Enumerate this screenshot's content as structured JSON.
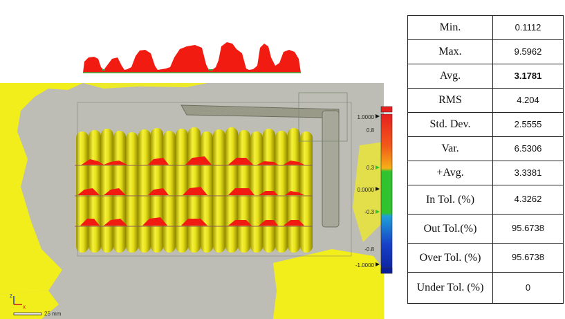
{
  "stats": [
    {
      "label": "Min.",
      "value": "0.1112"
    },
    {
      "label": "Max.",
      "value": "9.5962"
    },
    {
      "label": "Avg.",
      "value": "3.1781"
    },
    {
      "label": "RMS",
      "value": "4.204"
    },
    {
      "label": "Std. Dev.",
      "value": "2.5555"
    },
    {
      "label": "Var.",
      "value": "6.5306"
    },
    {
      "label": "+Avg.",
      "value": "3.3381"
    },
    {
      "label": "In Tol. (%)",
      "value": "4.3262"
    },
    {
      "label": "Out Tol.(%)",
      "value": "95.6738"
    },
    {
      "label": "Over Tol. (%)",
      "value": "95.6738"
    },
    {
      "label": "Under Tol. (%)",
      "value": "0"
    }
  ],
  "colorbar": {
    "ticks": [
      "1.0000",
      "0.8",
      "0.3",
      "0.0000",
      "-0.3",
      "-0.8",
      "-1.0000"
    ],
    "colors": {
      "max": "#e81f1f",
      "high": "#f25a1a",
      "mid_high": "#f6b017",
      "tolerance": "#2fc42f",
      "mid_low": "#1fa0d8",
      "low": "#1740c8",
      "min": "#0b1f9a"
    }
  },
  "scale_bar": {
    "label": "25 mm"
  },
  "axes": {
    "x": "x",
    "z": "z"
  },
  "colors": {
    "scan_surface": "#f2ee1c",
    "background_plane": "#bdbdb5",
    "deviation": "#f21b12"
  }
}
